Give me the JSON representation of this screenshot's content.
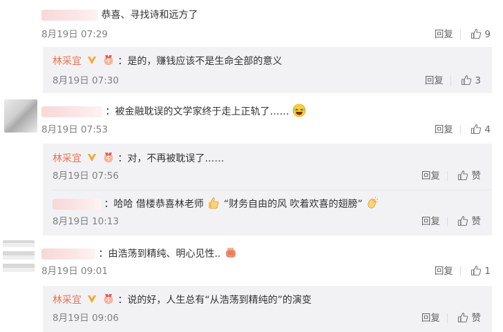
{
  "author": {
    "name": "林采宜"
  },
  "actions": {
    "reply": "回复",
    "like": "赞"
  },
  "c1": {
    "text": "恭喜、寻找诗和远方了",
    "time": "8月19日 07:29",
    "likes": "9"
  },
  "r1": {
    "text": "：是的，赚钱应该不是生命全部的意义",
    "time": "8月19日 07:30",
    "likes": "3"
  },
  "c2": {
    "text": "：被金融耽误的文学家终于走上正轨了……",
    "time": "8月19日 07:53",
    "likes": "4"
  },
  "r2a": {
    "text": "：对，不再被耽误了……",
    "time": "8月19日 07:56"
  },
  "r2b": {
    "text_a": "：哈哈 借楼恭喜林老师",
    "text_b": "“财务自由的风 吹着欢喜的翅膀”",
    "time": "8月19日 10:13"
  },
  "c3": {
    "text": "：由浩荡到精纯、明心见性..",
    "time": "8月19日 09:01",
    "likes": "1"
  },
  "r3": {
    "text": "：说的好，人生总有“从浩荡到精纯的”的演变",
    "time": "8月19日 09:06"
  },
  "icons": [
    "thumbs-up-icon",
    "verified-v-icon",
    "medal-icon",
    "laughing-emoji",
    "thumbs-up-emoji",
    "clap-emoji",
    "fist-emoji"
  ],
  "colors": {
    "username": "#eb7350",
    "reply_bg": "#f2f2f5",
    "meta": "#808080"
  }
}
